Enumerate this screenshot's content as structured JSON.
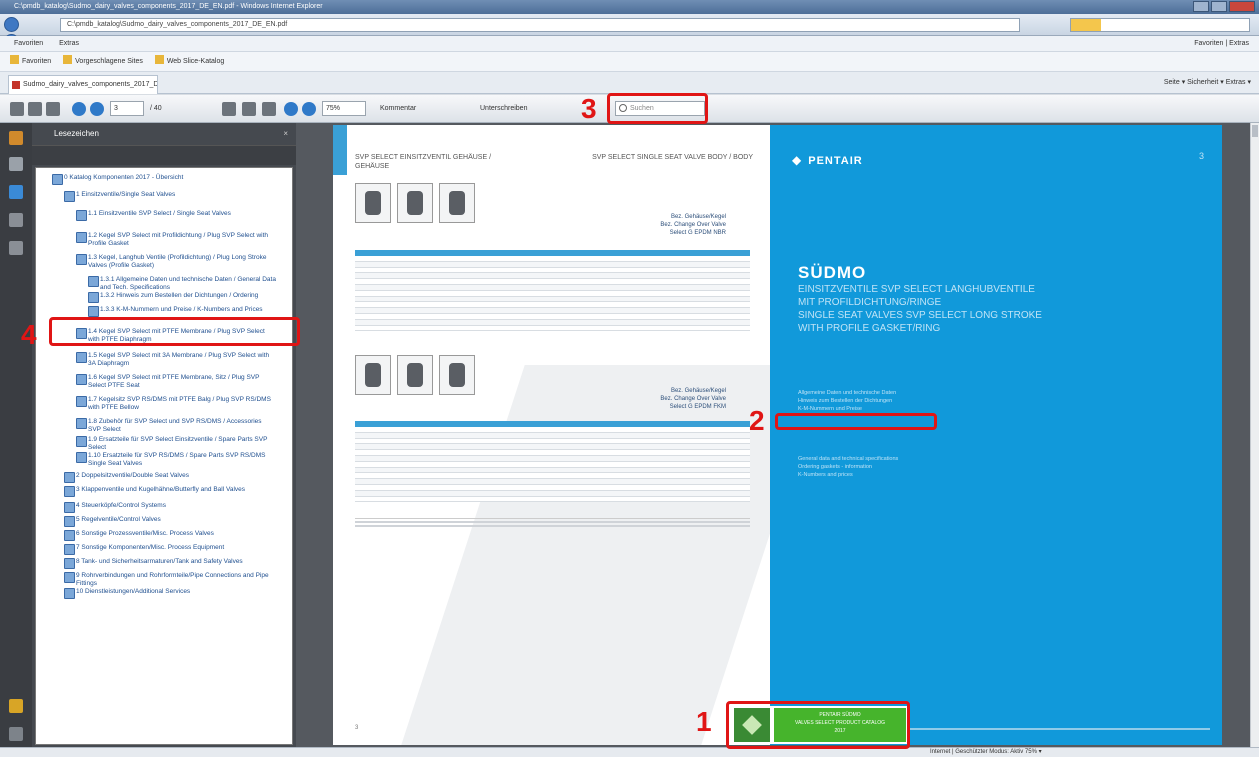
{
  "window": {
    "title": "C:\\pmdb_katalog\\Sudmo_dairy_valves_components_2017_DE_EN.pdf - Windows Internet Explorer"
  },
  "browser": {
    "url": "C:\\pmdb_katalog\\Sudmo_dairy_valves_components_2017_DE_EN.pdf",
    "menu": [
      "Favoriten",
      "Extras"
    ],
    "menu_right": "Favoriten  |  Extras",
    "favorites": [
      "Favoriten",
      "Vorgeschlagene Sites",
      "Web Slice-Katalog"
    ],
    "tab_label": "Sudmo_dairy_valves_components_2017_DE_EN.pdf",
    "tools": "Seite ▾  Sicherheit ▾  Extras ▾"
  },
  "pdf_toolbar": {
    "page_current": "3",
    "page_total": "/ 40",
    "zoom": "75%",
    "tool1": "Kommentar",
    "tool2": "Unterschreiben",
    "search_placeholder": "Suchen"
  },
  "bookmarks": {
    "title": "Lesezeichen",
    "items": [
      {
        "label": "0 Katalog Komponenten 2017 - Übersicht",
        "level": 0
      },
      {
        "label": "1 Einsitzventile/Single Seat Valves",
        "level": 1
      },
      {
        "label": "1.1 Einsitzventile SVP Select / Single Seat Valves",
        "level": 2
      },
      {
        "label": "1.2 Kegel SVP Select mit Profildichtung / Plug SVP Select with Profile Gasket",
        "level": 2
      },
      {
        "label": "1.3 Kegel, Langhub Ventile (Profildichtung) / Plug Long Stroke Valves (Profile Gasket)",
        "level": 2
      },
      {
        "label": "1.3.1 Allgemeine Daten und technische Daten / General Data and Tech. Specifications",
        "level": 3
      },
      {
        "label": "1.3.2 Hinweis zum Bestellen der Dichtungen / Ordering",
        "level": 3
      },
      {
        "label": "1.3.3 K-M-Nummern und Preise / K-Numbers and Prices",
        "level": 3
      },
      {
        "label": "1.4 Kegel SVP Select mit PTFE Membrane / Plug SVP Select with PTFE Diaphragm",
        "level": 2
      },
      {
        "label": "1.5 Kegel SVP Select mit 3A Membrane / Plug SVP Select with 3A Diaphragm",
        "level": 2
      },
      {
        "label": "1.6 Kegel SVP Select mit PTFE Membrane, Sitz / Plug SVP Select PTFE Seat",
        "level": 2
      },
      {
        "label": "1.7 Kegelsitz SVP RS/DMS mit PTFE Balg / Plug SVP RS/DMS with PTFE Bellow",
        "level": 2
      },
      {
        "label": "1.8 Zubehör für SVP Select und SVP RS/DMS / Accessories SVP Select",
        "level": 2
      },
      {
        "label": "1.9 Ersatzteile für SVP Select Einsitzventile / Spare Parts SVP Select",
        "level": 2
      },
      {
        "label": "1.10 Ersatzteile für SVP RS/DMS / Spare Parts SVP RS/DMS Single Seat Valves",
        "level": 2
      },
      {
        "label": "2 Doppelsitzventile/Double Seat Valves",
        "level": 1
      },
      {
        "label": "3 Klappenventile und Kugelhähne/Butterfly and Ball Valves",
        "level": 1
      },
      {
        "label": "4 Steuerköpfe/Control Systems",
        "level": 1
      },
      {
        "label": "5 Regelventile/Control Valves",
        "level": 1
      },
      {
        "label": "6 Sonstige Prozessventile/Misc. Process Valves",
        "level": 1
      },
      {
        "label": "7 Sonstige Komponenten/Misc. Process Equipment",
        "level": 1
      },
      {
        "label": "8 Tank- und Sicherheitsarmaturen/Tank and Safety Valves",
        "level": 1
      },
      {
        "label": "9 Rohrverbindungen und Rohrformteile/Pipe Connections and Pipe Fittings",
        "level": 1
      },
      {
        "label": "10 Dienstleistungen/Additional Services",
        "level": 1
      }
    ]
  },
  "page_left": {
    "header_left": "SVP SELECT EINSITZVENTIL GEHÄUSE / GEHÄUSE",
    "header_right": "SVP SELECT SINGLE SEAT VALVE BODY / BODY",
    "spec1": [
      "Bez. Gehäuse/Kegel",
      "Bez. Change Over Valve",
      "Select G EPDM NBR"
    ],
    "spec2": [
      "Bez. Gehäuse/Kegel",
      "Bez. Change Over Valve",
      "Select G EPDM FKM"
    ],
    "page_number": "3"
  },
  "page_right": {
    "logo": "PENTAIR",
    "page_number": "3",
    "brand": "SÜDMO",
    "subtitle_lines": [
      "Einsitzventile SVP Select Langhubventile",
      "mit Profildichtung/Ringe",
      "Single Seat Valves SVP Select Long Stroke",
      "with Profile Gasket/Ring"
    ],
    "info1": [
      "Allgemeine Daten und technische Daten",
      "Hinweis zum Bestellen der Dichtungen",
      "K-M-Nummern und Preise"
    ],
    "info2": [
      "General data and technical specifications",
      "Ordering gaskets - information",
      "K-Numbers and prices"
    ]
  },
  "badge": {
    "lines": [
      "Pentair Südmo",
      "Valves Select Product Catalog",
      "2017"
    ]
  },
  "statusbar": {
    "text": "Internet | Geschützter Modus: Aktiv   75% ▾"
  },
  "annotations": [
    "1",
    "2",
    "3",
    "4"
  ],
  "colors": {
    "annotation": "#e01515",
    "pentair_blue": "#1199da",
    "badge_green": "#46b42c"
  }
}
